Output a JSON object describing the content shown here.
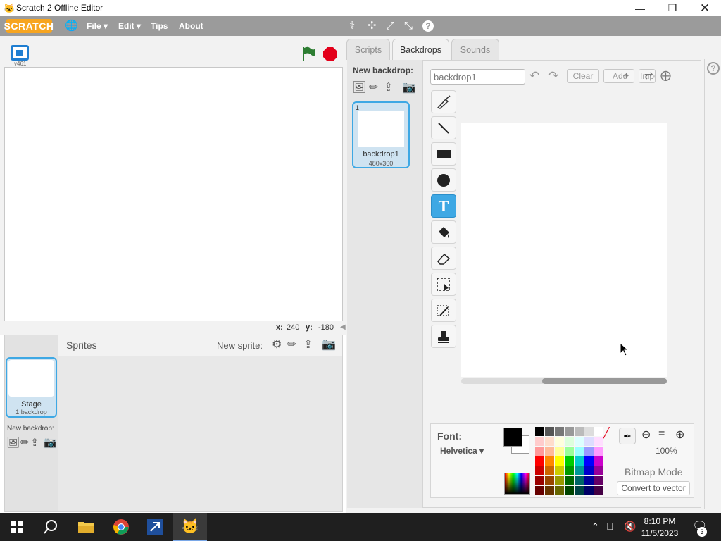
{
  "window": {
    "title": "Scratch 2 Offline Editor"
  },
  "menubar": {
    "logo": "SCRATCH",
    "file": "File",
    "edit": "Edit",
    "tips": "Tips",
    "about": "About"
  },
  "stage": {
    "version": "v461",
    "x_label": "x:",
    "x_value": "240",
    "y_label": "y:",
    "y_value": "-180"
  },
  "sprites": {
    "header": "Sprites",
    "new_sprite": "New sprite:",
    "stage_thumb": {
      "label": "Stage",
      "sub": "1 backdrop"
    },
    "new_backdrop": "New backdrop:"
  },
  "tabs": {
    "scripts": "Scripts",
    "backdrops": "Backdrops",
    "sounds": "Sounds"
  },
  "backdrop_list": {
    "new_backdrop": "New backdrop:",
    "items": [
      {
        "index": "1",
        "name": "backdrop1",
        "size": "480x360"
      }
    ]
  },
  "paint": {
    "name_value": "backdrop1",
    "clear": "Clear",
    "add": "Add",
    "import": "Import",
    "font_label": "Font:",
    "font_value": "Helvetica",
    "zoom": "100%",
    "mode": "Bitmap Mode",
    "convert": "Convert to vector"
  },
  "colors": {
    "primary": "#000000",
    "secondary": "#ffffff",
    "accent": "#3ea8e4",
    "go_flag": "#2d7d32",
    "stop": "#e3001b"
  },
  "taskbar": {
    "time": "8:10 PM",
    "date": "11/5/2023",
    "notifications": "3"
  }
}
